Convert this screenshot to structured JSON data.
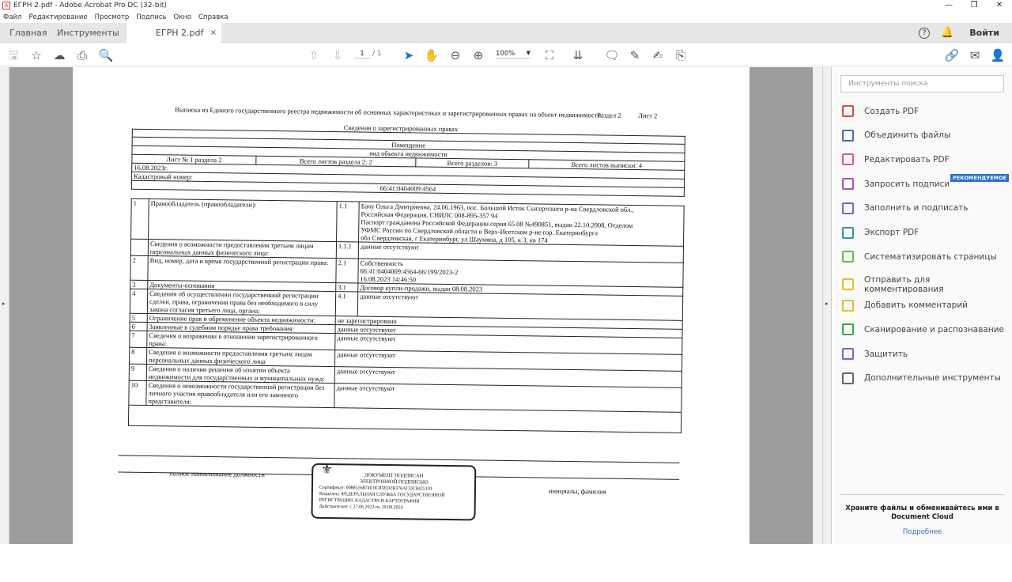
{
  "window": {
    "title": "ЕГРН 2.pdf - Adobe Acrobat Pro DC (32-bit)",
    "min": "—",
    "max": "❐",
    "close": "✕"
  },
  "menu": [
    "Файл",
    "Редактирование",
    "Просмотр",
    "Подпись",
    "Окно",
    "Справка"
  ],
  "tabs": {
    "home": "Главная",
    "tools": "Инструменты",
    "doc": "ЕГРН 2.pdf",
    "close": "×",
    "signin": "Войти"
  },
  "toolbar": {
    "page_current": "1",
    "page_total": "/ 1",
    "zoom": "100%"
  },
  "document": {
    "title": "Выписка из Единого государственного реестра недвижимости об основных характеристиках и зарегистрированных правах на объект недвижимости",
    "section": "Раздел 2",
    "sheet": "Лист 2",
    "subtitle": "Сведения о зарегистрированных правах",
    "object": "Помещение",
    "object_kind": "вид объекта недвижимости",
    "sheet_no": "Лист № 1 раздела 2",
    "sheets_in_section": "Всего листов раздела 2: 2",
    "sections": "Всего разделов: 3",
    "sheets_total": "Всего листов выписки: 4",
    "date": "16.08.2023г.",
    "cadastral_label": "Кадастровый номер:",
    "cadastral": "66:41:0404009:4564",
    "rows": [
      {
        "n": "1",
        "label": "Правообладатель (правообладатели):",
        "sub": "1.1",
        "value": "Бачу Ольга Дмитриевна, 24.06.1963, пос. Большой Исток Сысертского р-на Свердловской обл.,\nРоссийская Федерация, СНИЛС 008-895-357 94\nПаспорт гражданина Российской Федерации серия 65 08 №490851, выдан 22.10.2008, Отделом\nУФМС России по Свердловской области в Верх-Исетском р-не гор. Екатеринбурга\nобл Свердловская, г Екатеринбург, ул Шаумяна, д 105, к 3, кв 174"
      },
      {
        "n": "",
        "label": "Сведения о возможности предоставления третьим лицам персональных данных физического лица:",
        "sub": "1.1.1",
        "value": "данные отсутствуют"
      },
      {
        "n": "2",
        "label": "Вид, номер, дата и время государственной регистрации права:",
        "sub": "2.1",
        "value": "Собственность\n66:41:0404009:4564-66/199/2023-2\n16.08.2023 14:46:50"
      },
      {
        "n": "3",
        "label": "Документы-основания",
        "sub": "3.1",
        "value": "Договор купли-продажи, выдан 08.08.2023"
      },
      {
        "n": "4",
        "label": "Сведения об осуществлении государственной регистрации сделки, права, ограничения права без необходимого в силу закона согласия третьего лица, органа:",
        "sub": "4.1",
        "value": "данные отсутствуют"
      },
      {
        "n": "5",
        "label": "Ограничение прав и обременение объекта недвижимости:",
        "sub": "",
        "value": "не зарегистрировано"
      },
      {
        "n": "6",
        "label": "Заявленные в судебном порядке права требования:",
        "sub": "",
        "value": "данные отсутствуют"
      },
      {
        "n": "7",
        "label": "Сведения о возражении в отношении зарегистрированного права:",
        "sub": "",
        "value": "данные отсутствуют"
      },
      {
        "n": "8",
        "label": "Сведения о возможности предоставления третьим лицам персональных данных физического лица",
        "sub": "",
        "value": "данные отсутствуют"
      },
      {
        "n": "9",
        "label": "Сведения о наличии решения об изъятии объекта недвижимости для государственных и муниципальных нужд:",
        "sub": "",
        "value": "данные отсутствуют"
      },
      {
        "n": "10",
        "label": "Сведения о невозможности государственной регистрации без личного участия правообладателя или его законного представителя:",
        "sub": "",
        "value": "данные отсутствуют"
      }
    ],
    "position": "полное наименование должности",
    "initials": "инициалы, фамилия",
    "stamp": {
      "l1": "ДОКУМЕНТ ПОДПИСАН",
      "l2": "ЭЛЕКТРОННОЙ ПОДПИСЬЮ",
      "cert": "Сертификат: 00885568740 0C83ED2B376ACDC8425101",
      "owner": "Владелец: ФЕДЕРАЛЬНАЯ СЛУЖБА ГОСУДАРСТВЕННОЙ",
      "owner2": "РЕГИСТРАЦИИ, КАДАСТРА И КАРТОГРАФИИ",
      "valid": "Действителен: с 27.06.2023 по 19.09.2024"
    }
  },
  "panel": {
    "search_placeholder": "Инструменты поиска",
    "badge": "РЕКОМЕНДУЕМОЕ",
    "tools": [
      {
        "label": "Создать PDF",
        "color": "#e0474c"
      },
      {
        "label": "Объединить файлы",
        "color": "#5b5bd6"
      },
      {
        "label": "Редактировать PDF",
        "color": "#e05a7a"
      },
      {
        "label": "Запросить подписи",
        "color": "#b04fc0"
      },
      {
        "label": "Заполнить и подписать",
        "color": "#8a5ad6"
      },
      {
        "label": "Экспорт PDF",
        "color": "#2a9a9a"
      },
      {
        "label": "Систематизировать страницы",
        "color": "#6cbf3a"
      },
      {
        "label": "Отправить для комментирования",
        "color": "#e5c020"
      },
      {
        "label": "Добавить комментарий",
        "color": "#e5c020"
      },
      {
        "label": "Сканирование и распознавание",
        "color": "#3aa84a"
      },
      {
        "label": "Защитить",
        "color": "#6a6ad0"
      },
      {
        "label": "Дополнительные инструменты",
        "color": "#666666"
      }
    ],
    "cloud_text": "Храните файлы и обменивайтесь ими в Document Cloud",
    "cloud_link": "Подробнее"
  }
}
